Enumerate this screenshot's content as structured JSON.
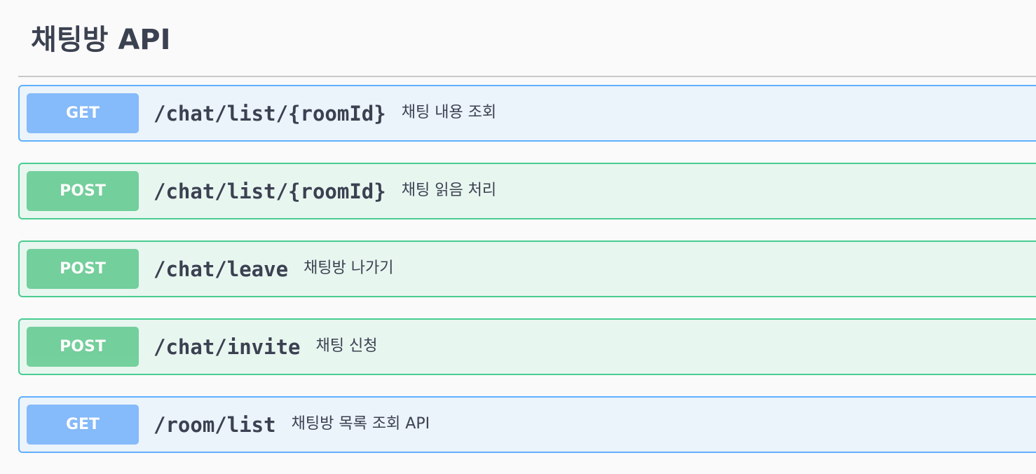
{
  "section": {
    "title": "채팅방 API"
  },
  "operations": [
    {
      "method": "GET",
      "path": "/chat/list/{roomId}",
      "summary": "채팅 내용 조회"
    },
    {
      "method": "POST",
      "path": "/chat/list/{roomId}",
      "summary": "채팅 읽음 처리"
    },
    {
      "method": "POST",
      "path": "/chat/leave",
      "summary": "채팅방 나가기"
    },
    {
      "method": "POST",
      "path": "/chat/invite",
      "summary": "채팅 신청"
    },
    {
      "method": "GET",
      "path": "/room/list",
      "summary": "채팅방 목록 조회 API"
    }
  ],
  "colors": {
    "get_border": "#61affe",
    "get_background": "#ebf3fb",
    "get_badge": "#74b1fb",
    "post_border": "#49cc90",
    "post_background": "#e8f6f0",
    "post_badge": "#5fc98d",
    "text": "#3b4151"
  }
}
